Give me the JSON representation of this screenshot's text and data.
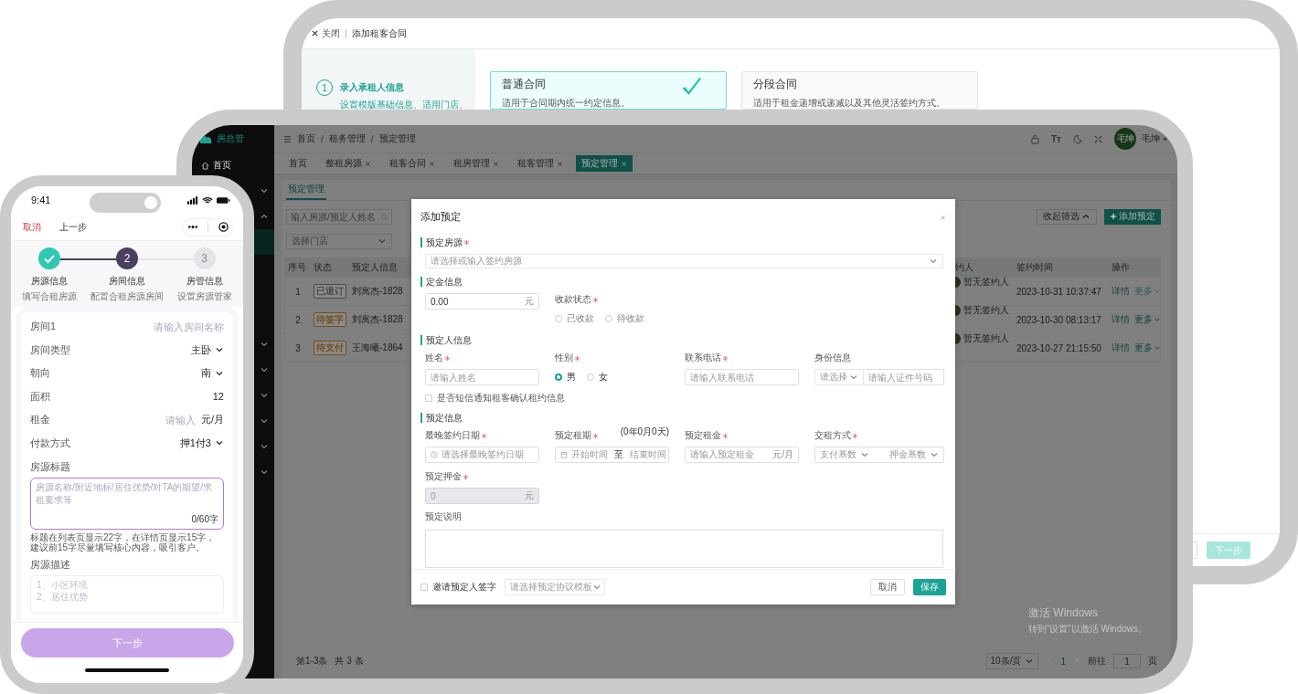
{
  "back_window": {
    "close": "关闭",
    "title": "添加租客合同",
    "step": {
      "number": "1",
      "title": "录入承租人信息",
      "desc": "设置模版基础信息、适用门店、"
    },
    "contract_types": [
      {
        "title": "普通合同",
        "desc": "适用于合同期内统一约定信息。",
        "selected": true
      },
      {
        "title": "分段合同",
        "desc": "适用于租金递增或递减以及其他灵活签约方式。",
        "selected": false
      }
    ],
    "next_button": "下一步"
  },
  "admin": {
    "logo": "房总管",
    "sidebar": [
      {
        "kind": "home",
        "label": "首页"
      },
      {
        "kind": "group",
        "expanded": false
      },
      {
        "kind": "group",
        "expanded": true
      },
      {
        "kind": "child",
        "selected": true
      },
      {
        "kind": "group",
        "expanded": false
      },
      {
        "kind": "group",
        "expanded": false
      },
      {
        "kind": "group",
        "expanded": false
      },
      {
        "kind": "group",
        "expanded": false
      },
      {
        "kind": "group",
        "expanded": false
      },
      {
        "kind": "group",
        "expanded": false
      }
    ],
    "breadcrumb": [
      {
        "kind": "link",
        "text": "首页"
      },
      {
        "kind": "separator",
        "text": "/"
      },
      {
        "kind": "link",
        "text": "租务管理"
      },
      {
        "kind": "separator",
        "text": "/"
      },
      {
        "kind": "current",
        "text": "预定管理"
      }
    ],
    "font_size_glyph": "Tт",
    "user": {
      "avatar": "毛坤",
      "name": "毛坤"
    },
    "tabs": [
      {
        "label": "首页",
        "closable": false,
        "selected": false
      },
      {
        "label": "整租房源",
        "closable": true,
        "selected": false
      },
      {
        "label": "租客合同",
        "closable": true,
        "selected": false
      },
      {
        "label": "租房管理",
        "closable": true,
        "selected": false
      },
      {
        "label": "租客管理",
        "closable": true,
        "selected": false
      },
      {
        "label": "预定管理",
        "closable": true,
        "selected": true
      }
    ],
    "page_tab": "预定管理",
    "search": {
      "placeholder": "输入房源/预定人姓名"
    },
    "store_select": {
      "placeholder": "选择门店"
    },
    "collapse_button": "收起筛选",
    "add_button": "添加预定",
    "table": {
      "columns": [
        "序号",
        "状态",
        "预定人信息",
        "约人",
        "签约时间",
        "操作"
      ],
      "rows": [
        {
          "no": "1",
          "status": "已退订",
          "color": "#48494c",
          "person": "刘寓杰-1828",
          "signer": "暂无签约人",
          "time": "2023-10-31 10:37:47",
          "detail": "详情",
          "more": "更多",
          "more_disabled": true
        },
        {
          "no": "2",
          "status": "待签字",
          "color": "#73511e",
          "person": "刘寓杰-1828",
          "signer": "暂无签约人",
          "time": "2023-10-30 08:13:17",
          "detail": "详情",
          "more": "更多",
          "more_disabled": false
        },
        {
          "no": "3",
          "status": "待支付",
          "color": "#73511e",
          "person": "王海曦-1864",
          "signer": "暂无签约人",
          "time": "2023-10-27 21:15:50",
          "detail": "详情",
          "more": "更多",
          "more_disabled": false
        }
      ]
    },
    "footer": {
      "count": "第1-3条",
      "total": "共 3 条",
      "page_size": "10条/页",
      "current_page": "1",
      "goto": "前往",
      "goto_value": "1",
      "page_unit": "页"
    },
    "watermark": [
      "激活 Windows",
      "转到“设置”以激活 Windows。"
    ]
  },
  "modal": {
    "title": "添加预定",
    "room": {
      "heading": "预定房源",
      "required": true,
      "placeholder": "请选择或输入签约房源"
    },
    "deposit": {
      "heading": "定金信息",
      "amount": "0.00",
      "unit": "元",
      "status_label": "收款状态",
      "required": true,
      "options": [
        {
          "label": "已收款",
          "selected": false
        },
        {
          "label": "待收款",
          "selected": false
        }
      ]
    },
    "person": {
      "heading": "预定人信息",
      "fields": [
        {
          "kind": "input",
          "label": "姓名",
          "required": true,
          "placeholder": "请输入姓名"
        },
        {
          "kind": "radio",
          "label": "性别",
          "required": true,
          "options": [
            {
              "label": "男",
              "selected": true
            },
            {
              "label": "女",
              "selected": false
            }
          ]
        },
        {
          "kind": "input",
          "label": "联系电话",
          "required": true,
          "placeholder": "请输入联系电话"
        },
        {
          "kind": "id",
          "label": "身份信息",
          "required": false,
          "select_placeholder": "请选择",
          "placeholder": "请输入证件号码"
        }
      ],
      "sms": {
        "label": "是否短信通知租客确认租约信息",
        "checked": false
      }
    },
    "booking": {
      "heading": "预定信息",
      "fields": [
        {
          "kind": "date",
          "label": "最晚签约日期",
          "required": true,
          "placeholder": "请选择最晚签约日期"
        },
        {
          "kind": "range",
          "label": "预定租期",
          "required": true,
          "note": "(0年0月0天)",
          "start": "开始时间",
          "separator": "至",
          "end": "结束时间"
        },
        {
          "kind": "unit",
          "label": "预定租金",
          "required": true,
          "disabled": false,
          "placeholder": "请输入预定租金",
          "unit": "元/月"
        },
        {
          "kind": "pair",
          "label": "交租方式",
          "required": true,
          "first": "支付基数",
          "second": "押金基数"
        },
        {
          "kind": "unit",
          "label": "预定押金",
          "required": true,
          "disabled": true,
          "placeholder": "0",
          "unit": "元"
        }
      ],
      "note_label": "预定说明"
    },
    "footer": {
      "invite": {
        "label": "邀请预定人签字",
        "checked": false
      },
      "template_placeholder": "请选择预定协议模板",
      "cancel": "取消",
      "save": "保存"
    }
  },
  "phone": {
    "time": "9:41",
    "cancel": "取消",
    "back": "上一步",
    "steps": [
      {
        "kind": "done",
        "title": "房源信息",
        "desc": "填写合租房源"
      },
      {
        "kind": "current",
        "number": "2",
        "title": "房间信息",
        "desc": "配置合租房源房间"
      },
      {
        "kind": "todo",
        "number": "3",
        "title": "房管信息",
        "desc": "设置房源管家"
      }
    ],
    "rows": [
      {
        "kind": "input",
        "label": "房间1",
        "placeholder": "请输入房间名称"
      },
      {
        "kind": "select",
        "label": "房间类型",
        "value": "主卧"
      },
      {
        "kind": "select",
        "label": "朝向",
        "value": "南"
      },
      {
        "kind": "value",
        "label": "面积",
        "value": "12"
      },
      {
        "kind": "unit",
        "label": "租金",
        "placeholder": "请输入",
        "unit": "元/月"
      },
      {
        "kind": "select",
        "label": "付款方式",
        "value": "押1付3"
      }
    ],
    "title_field": {
      "label": "房源标题",
      "placeholder": "房源名称/附近地标/居住优势/对TA的期望/求租要求等",
      "counter": "0/60字",
      "hint": "标题在列表页显示22字，在详情页显示15字，建议前15字尽量填写核心内容，吸引客户。"
    },
    "desc_field": {
      "label": "房源描述",
      "placeholder": "1、小区环境\n2、居住优势"
    },
    "next_button": "下一步"
  }
}
